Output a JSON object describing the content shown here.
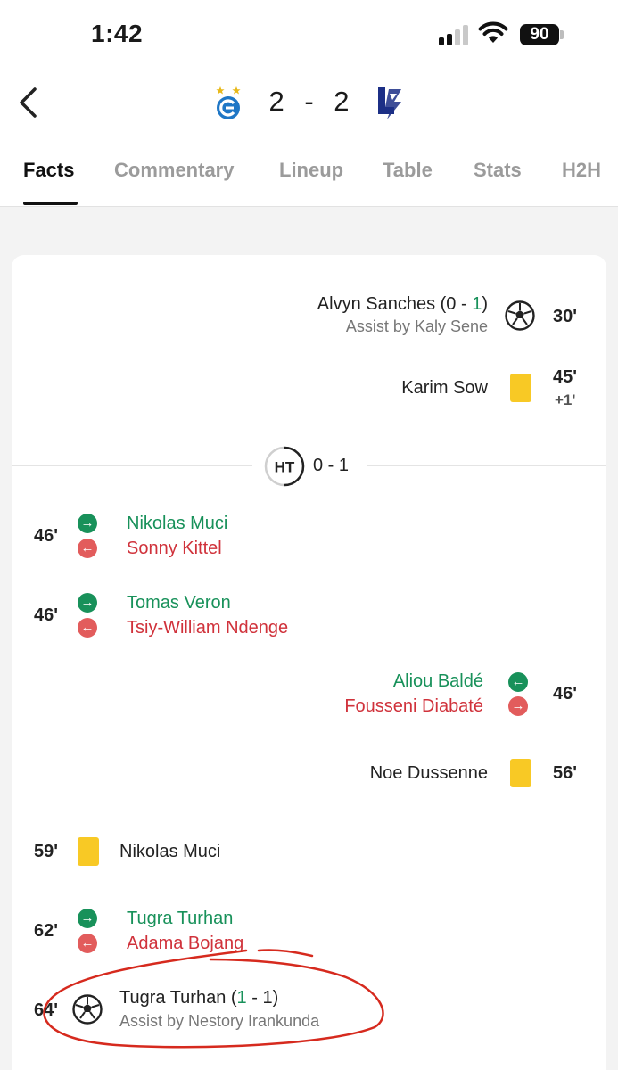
{
  "status_bar": {
    "time": "1:42",
    "battery": "90"
  },
  "match": {
    "home_score": "2",
    "separator": "-",
    "away_score": "2"
  },
  "tabs": [
    "Facts",
    "Commentary",
    "Lineup",
    "Table",
    "Stats",
    "H2H"
  ],
  "active_tab": "Facts",
  "events": {
    "goal_sanches": {
      "player": "Alvyn Sanches",
      "score_home": "0",
      "score_away": "1",
      "assist": "Assist by Kaly Sene",
      "minute": "30'"
    },
    "card_sow": {
      "player": "Karim Sow",
      "minute": "45'",
      "added": "+1'"
    },
    "halftime": {
      "label": "HT",
      "score": "0 - 1"
    },
    "sub_1": {
      "minute": "46'",
      "in": "Nikolas Muci",
      "out": "Sonny Kittel"
    },
    "sub_2": {
      "minute": "46'",
      "in": "Tomas Veron",
      "out": "Tsiy-William Ndenge"
    },
    "sub_3": {
      "minute": "46'",
      "in": "Aliou Baldé",
      "out": "Fousseni Diabaté"
    },
    "card_dussenne": {
      "player": "Noe Dussenne",
      "minute": "56'"
    },
    "card_muci": {
      "player": "Nikolas Muci",
      "minute": "59'"
    },
    "sub_4": {
      "minute": "62'",
      "in": "Tugra Turhan",
      "out": "Adama Bojang"
    },
    "goal_turhan": {
      "player": "Tugra Turhan",
      "score_home": "1",
      "score_away": "1",
      "assist": "Assist by Nestory Irankunda",
      "minute": "64'"
    }
  },
  "icons": {
    "back": "chevron-left-icon",
    "goal": "soccer-ball-icon",
    "yellow_card": "yellow-card-icon",
    "sub_in": "arrow-right-icon",
    "sub_out": "arrow-left-icon"
  },
  "colors": {
    "sub_in": "#18915a",
    "sub_out": "#d0323b",
    "yellow_card": "#f8c925",
    "annotation": "#d62a1e"
  }
}
